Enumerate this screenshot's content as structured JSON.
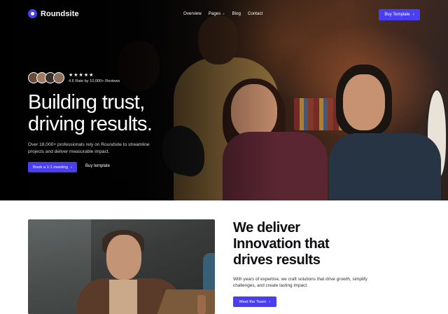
{
  "nav": {
    "brand": "Roundsite",
    "links": [
      {
        "label": "Overview"
      },
      {
        "label": "Pages",
        "has_dropdown": true
      },
      {
        "label": "Blog"
      },
      {
        "label": "Contact"
      }
    ],
    "cta_label": "Buy Template",
    "cta_icon": "chevron-right-icon"
  },
  "hero": {
    "rating_stars": "★★★★★",
    "rating_text": "4.6 Rate by 10,000+ Reviews",
    "title_line1": "Building trust,",
    "title_line2": "driving results.",
    "subtitle": "Over 18,000+ professionals rely on Roundsite to streamline projects and deliver measurable impact.",
    "primary_cta": "Book a 1:1 meeting",
    "secondary_cta": "Buy template",
    "avatar_colors": [
      "#6b4a3a",
      "#a27a5f",
      "#3a2e2a",
      "#8a6e5a"
    ]
  },
  "section2": {
    "title_line1": "We deliver",
    "title_line2": "Innovation that",
    "title_line3": "drives results",
    "subtitle": "With years of expertise, we craft solutions that drive growth, simplify challenges, and create lasting impact.",
    "cta_label": "Meet the Team"
  },
  "colors": {
    "accent": "#4a3ff0",
    "hero_bg": "#0b0b0d"
  }
}
